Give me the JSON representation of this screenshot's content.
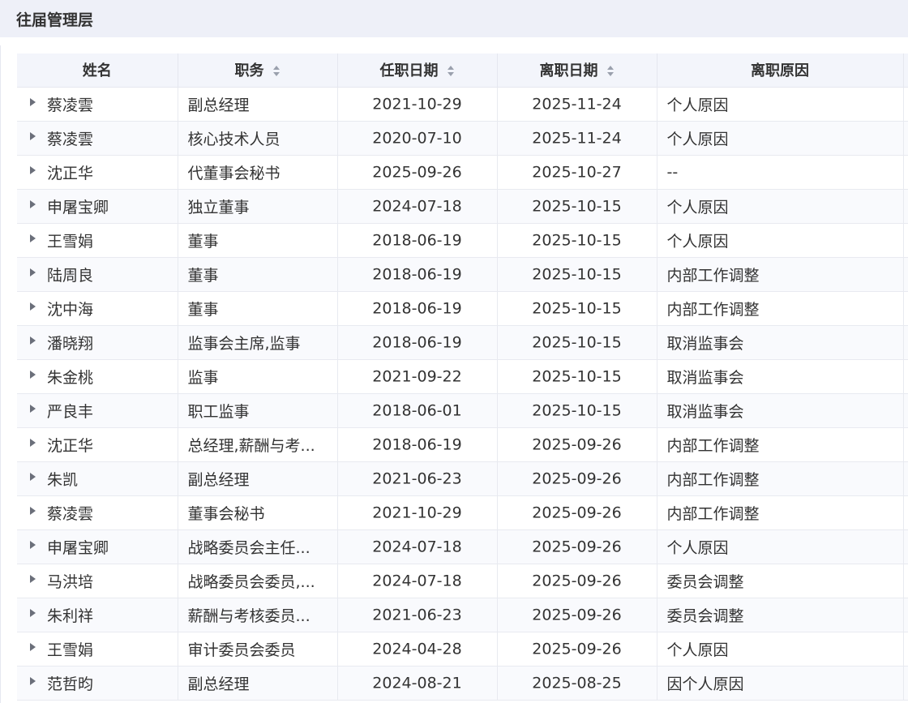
{
  "section": {
    "title": "往届管理层"
  },
  "table": {
    "columns": [
      {
        "label": "姓名",
        "sortable": false
      },
      {
        "label": "职务",
        "sortable": true
      },
      {
        "label": "任职日期",
        "sortable": true
      },
      {
        "label": "离职日期",
        "sortable": true
      },
      {
        "label": "离职原因",
        "sortable": false
      }
    ],
    "rows": [
      {
        "name": "蔡凌雲",
        "position": "副总经理",
        "start": "2021-10-29",
        "end": "2025-11-24",
        "reason": "个人原因"
      },
      {
        "name": "蔡凌雲",
        "position": "核心技术人员",
        "start": "2020-07-10",
        "end": "2025-11-24",
        "reason": "个人原因"
      },
      {
        "name": "沈正华",
        "position": "代董事会秘书",
        "start": "2025-09-26",
        "end": "2025-10-27",
        "reason": "--"
      },
      {
        "name": "申屠宝卿",
        "position": "独立董事",
        "start": "2024-07-18",
        "end": "2025-10-15",
        "reason": "个人原因"
      },
      {
        "name": "王雪娟",
        "position": "董事",
        "start": "2018-06-19",
        "end": "2025-10-15",
        "reason": "个人原因"
      },
      {
        "name": "陆周良",
        "position": "董事",
        "start": "2018-06-19",
        "end": "2025-10-15",
        "reason": "内部工作调整"
      },
      {
        "name": "沈中海",
        "position": "董事",
        "start": "2018-06-19",
        "end": "2025-10-15",
        "reason": "内部工作调整"
      },
      {
        "name": "潘晓翔",
        "position": "监事会主席,监事",
        "start": "2018-06-19",
        "end": "2025-10-15",
        "reason": "取消监事会"
      },
      {
        "name": "朱金桃",
        "position": "监事",
        "start": "2021-09-22",
        "end": "2025-10-15",
        "reason": "取消监事会"
      },
      {
        "name": "严良丰",
        "position": "职工监事",
        "start": "2018-06-01",
        "end": "2025-10-15",
        "reason": "取消监事会"
      },
      {
        "name": "沈正华",
        "position": "总经理,薪酬与考...",
        "start": "2018-06-19",
        "end": "2025-09-26",
        "reason": "内部工作调整"
      },
      {
        "name": "朱凯",
        "position": "副总经理",
        "start": "2021-06-23",
        "end": "2025-09-26",
        "reason": "内部工作调整"
      },
      {
        "name": "蔡凌雲",
        "position": "董事会秘书",
        "start": "2021-10-29",
        "end": "2025-09-26",
        "reason": "内部工作调整"
      },
      {
        "name": "申屠宝卿",
        "position": "战略委员会主任...",
        "start": "2024-07-18",
        "end": "2025-09-26",
        "reason": "个人原因"
      },
      {
        "name": "马洪培",
        "position": "战略委员会委员,...",
        "start": "2024-07-18",
        "end": "2025-09-26",
        "reason": "委员会调整"
      },
      {
        "name": "朱利祥",
        "position": "薪酬与考核委员...",
        "start": "2021-06-23",
        "end": "2025-09-26",
        "reason": "委员会调整"
      },
      {
        "name": "王雪娟",
        "position": "审计委员会委员",
        "start": "2024-04-28",
        "end": "2025-09-26",
        "reason": "个人原因"
      },
      {
        "name": "范哲昀",
        "position": "副总经理",
        "start": "2024-08-21",
        "end": "2025-08-25",
        "reason": "因个人原因"
      }
    ]
  }
}
